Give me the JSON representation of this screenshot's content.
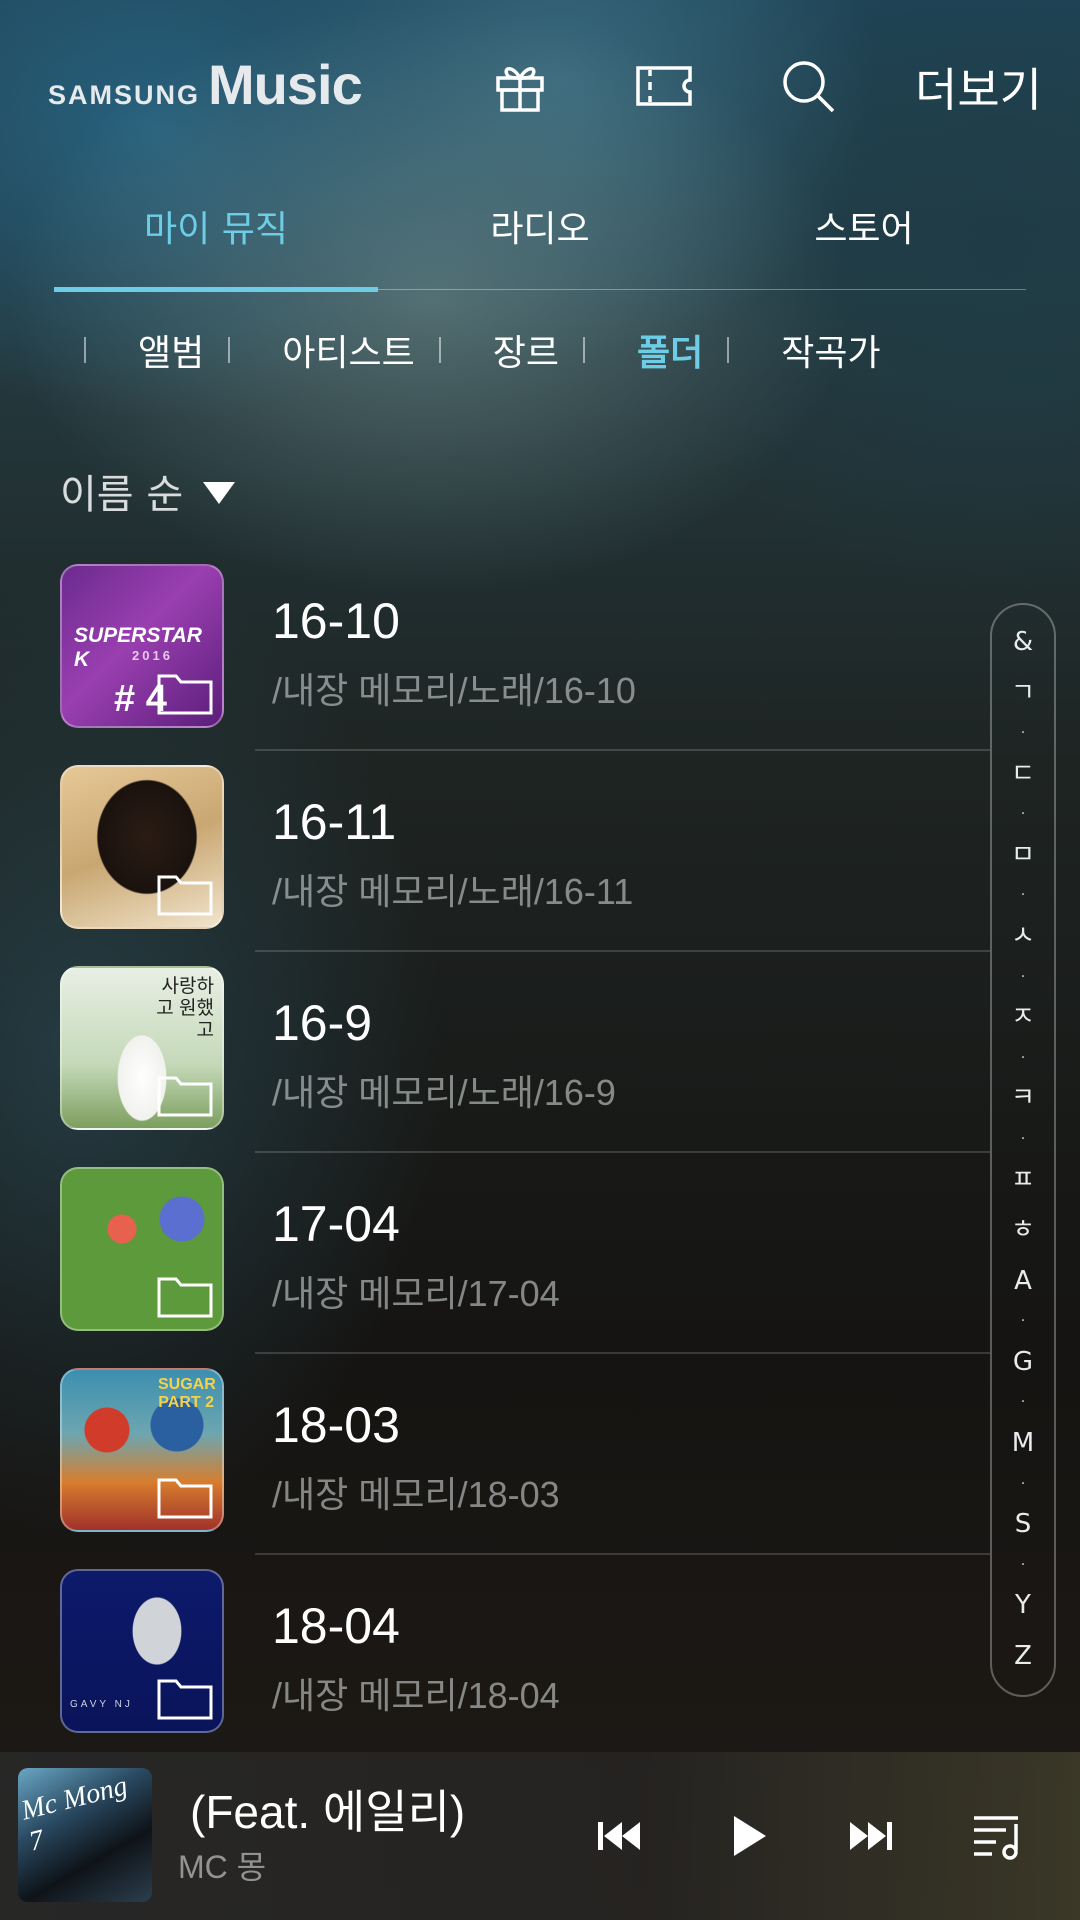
{
  "header": {
    "logo_brand": "SAMSUNG",
    "logo_product": "Music",
    "more_label": "더보기",
    "icons": [
      "gift-icon",
      "ticket-icon",
      "search-icon"
    ]
  },
  "main_tabs": [
    {
      "label": "마이 뮤직",
      "active": true
    },
    {
      "label": "라디오",
      "active": false
    },
    {
      "label": "스토어",
      "active": false
    }
  ],
  "sub_tabs": [
    {
      "label": "앨범",
      "active": false
    },
    {
      "label": "아티스트",
      "active": false
    },
    {
      "label": "장르",
      "active": false
    },
    {
      "label": "폴더",
      "active": true
    },
    {
      "label": "작곡가",
      "active": false
    }
  ],
  "sort": {
    "label": "이름 순"
  },
  "folders": [
    {
      "name": "16-10",
      "path": "/내장 메모리/노래/16-10",
      "thumb_text": "SUPERSTAR K",
      "thumb_sub": "2016",
      "thumb_num": "# 4"
    },
    {
      "name": "16-11",
      "path": "/내장 메모리/노래/16-11"
    },
    {
      "name": "16-9",
      "path": "/내장 메모리/노래/16-9",
      "thumb_text": "사랑하고 원했고"
    },
    {
      "name": "17-04",
      "path": "/내장 메모리/17-04"
    },
    {
      "name": "18-03",
      "path": "/내장 메모리/18-03",
      "thumb_text": "SUGAR PART 2"
    },
    {
      "name": "18-04",
      "path": "/내장 메모리/18-04",
      "thumb_text": "GAVY NJ"
    }
  ],
  "index_bar": [
    "&",
    "ㄱ",
    "·",
    "ㄷ",
    "·",
    "ㅁ",
    "·",
    "ㅅ",
    "·",
    "ㅈ",
    "·",
    "ㅋ",
    "·",
    "ㅍ",
    "ㅎ",
    "A",
    "·",
    "G",
    "·",
    "M",
    "·",
    "S",
    "·",
    "Y",
    "Z"
  ],
  "player": {
    "song": "(Feat. 에일리)",
    "artist": "MC 몽",
    "art_text": "Mc Mong 7",
    "controls": [
      "previous-icon",
      "play-icon",
      "next-icon",
      "playlist-icon"
    ]
  },
  "colors": {
    "accent": "#6dcde6",
    "text": "#ffffff",
    "subtext": "#9ea3a3"
  }
}
